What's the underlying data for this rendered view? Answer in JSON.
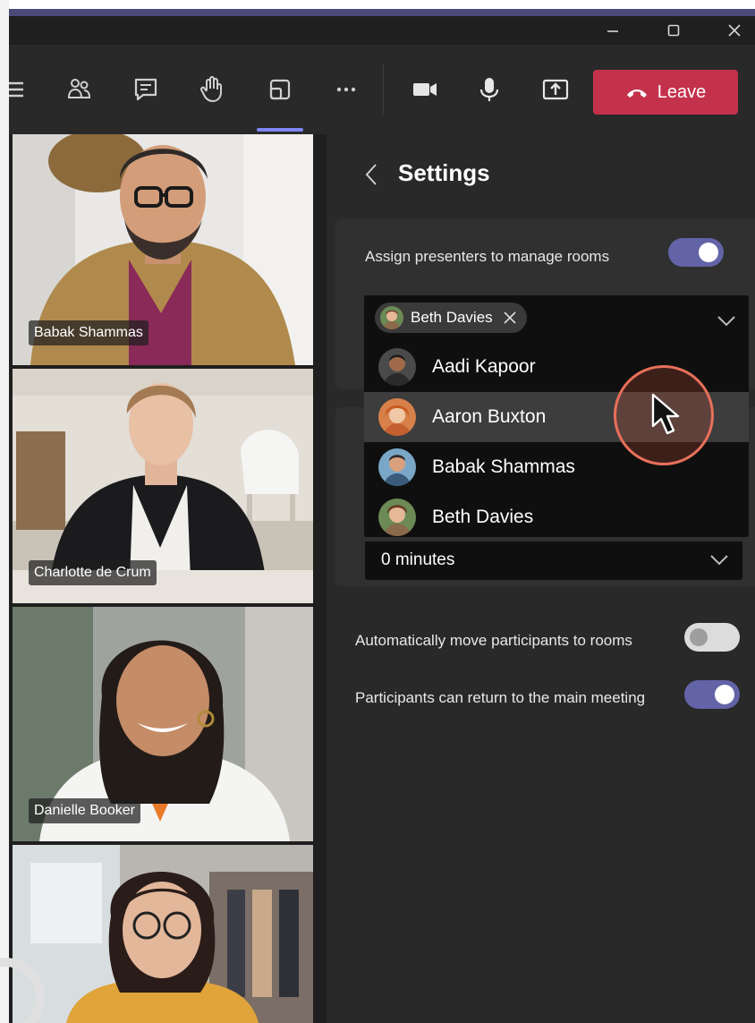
{
  "window": {
    "minimize_icon": "minimize-icon",
    "maximize_icon": "maximize-icon",
    "close_icon": "close-icon"
  },
  "toolbar": {
    "items": [
      "menu-icon",
      "people-icon",
      "chat-icon",
      "raise-hand-icon",
      "rooms-icon",
      "more-icon",
      "camera-icon",
      "mic-icon",
      "share-icon"
    ],
    "leave_label": "Leave"
  },
  "videos": {
    "tiles": [
      {
        "name": "Babak Shammas"
      },
      {
        "name": "Charlotte de Crum"
      },
      {
        "name": "Danielle Booker"
      },
      {
        "name": ""
      }
    ]
  },
  "settings": {
    "title": "Settings",
    "assign_presenters_label": "Assign presenters to manage rooms",
    "assign_presenters_on": true,
    "selected_chip": "Beth Davies",
    "options": [
      "Aadi Kapoor",
      "Aaron Buxton",
      "Babak Shammas",
      "Beth Davies"
    ],
    "highlighted_option": "Aaron Buxton",
    "minutes_value": "0 minutes",
    "auto_move_label": "Automatically move participants to rooms",
    "auto_move_on": false,
    "return_label": "Participants can return to the main meeting",
    "return_on": true
  },
  "colors": {
    "accent": "#6264a7",
    "leave": "#c4314b",
    "panel": "#292929",
    "background": "#1f1f1f"
  }
}
